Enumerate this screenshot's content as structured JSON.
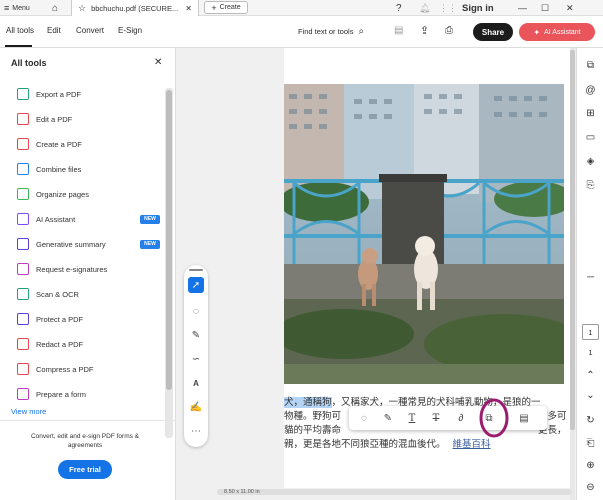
{
  "titlebar": {
    "menu_label": "Menu",
    "doc_tab_title": "bbchuchu.pdf (SECURE...",
    "create_label": "Create",
    "sign_in_label": "Sign in"
  },
  "toolbar": {
    "tabs": [
      "All tools",
      "Edit",
      "Convert",
      "E-Sign"
    ],
    "find_label": "Find text or tools",
    "share_label": "Share",
    "ai_label": "AI Assistant"
  },
  "left_panel": {
    "title": "All tools",
    "tools": [
      {
        "label": "Export a PDF",
        "color": "#2d9d78",
        "badge": ""
      },
      {
        "label": "Edit a PDF",
        "color": "#e34850",
        "badge": ""
      },
      {
        "label": "Create a PDF",
        "color": "#e34850",
        "badge": ""
      },
      {
        "label": "Combine files",
        "color": "#2680eb",
        "badge": ""
      },
      {
        "label": "Organize pages",
        "color": "#44b556",
        "badge": ""
      },
      {
        "label": "AI Assistant",
        "color": "#7c4dff",
        "badge": "NEW"
      },
      {
        "label": "Generative summary",
        "color": "#5c3fd6",
        "badge": "NEW"
      },
      {
        "label": "Request e-signatures",
        "color": "#b83fbd",
        "badge": ""
      },
      {
        "label": "Scan & OCR",
        "color": "#2d9d78",
        "badge": ""
      },
      {
        "label": "Protect a PDF",
        "color": "#5c3fd6",
        "badge": ""
      },
      {
        "label": "Redact a PDF",
        "color": "#e34850",
        "badge": ""
      },
      {
        "label": "Compress a PDF",
        "color": "#e34850",
        "badge": ""
      },
      {
        "label": "Prepare a form",
        "color": "#b83fbd",
        "badge": ""
      }
    ],
    "view_more_label": "View more",
    "promo_text": "Convert, edit and e-sign PDF forms & agreements",
    "free_trial_label": "Free trial"
  },
  "document": {
    "lines": [
      {
        "pre": "",
        "highlight": "犬，通稱狗",
        "post": "，又稱家犬，一種常見的犬科哺乳動物，是狼的一"
      },
      {
        "pre": "物種。野狗可",
        "highlight": "",
        "post": "最多可"
      },
      {
        "pre": "貓的平均壽命",
        "highlight": "",
        "post": "更長，"
      },
      {
        "pre": "親，更是各地不同狼亞種的混血後代。",
        "highlight": "",
        "post": "維基百科"
      }
    ],
    "page_size_label": "8.50 x 11.00 in"
  },
  "right_rail": {
    "page_number": "1",
    "page_total": "1"
  },
  "colors": {
    "accent_blue": "#1473e6",
    "ai_button": "#e9555a",
    "highlight_circle": "#9b1b6f",
    "text_highlight": "#b3d4f5"
  }
}
